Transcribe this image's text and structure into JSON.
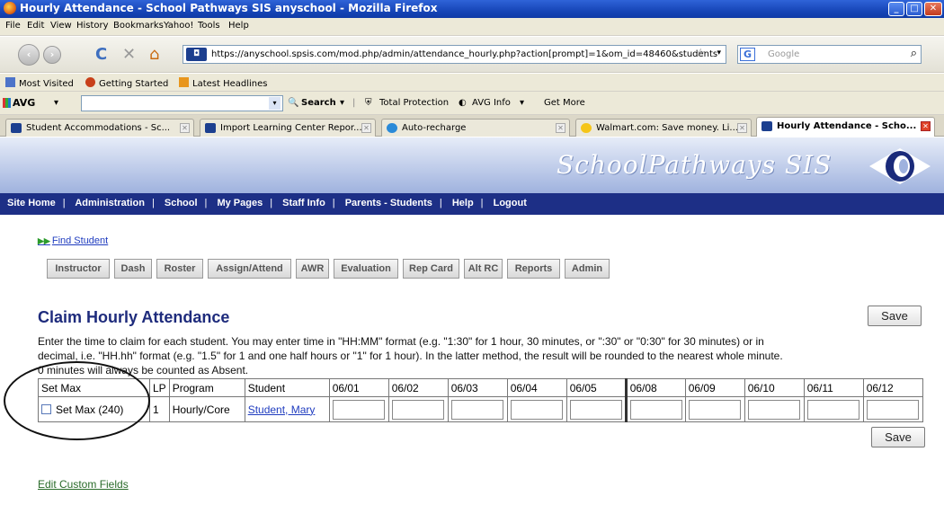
{
  "window": {
    "title": "Hourly Attendance - School Pathways SIS anyschool - Mozilla Firefox"
  },
  "menu": [
    "File",
    "Edit",
    "View",
    "History",
    "Bookmarks",
    "Yahoo!",
    "Tools",
    "Help"
  ],
  "address": {
    "url": "https://anyschool.spsis.com/mod.php/admin/attendance_hourly.php?action[prompt]=1&om_id=48460&students"
  },
  "search": {
    "placeholder": "Google"
  },
  "bookmarks": [
    "Most Visited",
    "Getting Started",
    "Latest Headlines"
  ],
  "avg": {
    "brand": "AVG",
    "search": "Search",
    "total_protection": "Total Protection",
    "info": "AVG Info",
    "get_more": "Get More"
  },
  "tabs": [
    {
      "label": "Student Accommodations - Sc...",
      "active": false
    },
    {
      "label": "Import Learning Center Repor...",
      "active": false
    },
    {
      "label": "Auto-recharge",
      "active": false
    },
    {
      "label": "Walmart.com: Save money. Li...",
      "active": false
    },
    {
      "label": "Hourly Attendance - Scho...",
      "active": true
    }
  ],
  "site": {
    "brand": "SchoolPathways SIS",
    "nav": [
      "Site Home",
      "Administration",
      "School",
      "My Pages",
      "Staff Info",
      "Parents - Students",
      "Help",
      "Logout"
    ]
  },
  "page": {
    "find_student": "Find Student",
    "subtabs": [
      "Instructor",
      "Dash",
      "Roster",
      "Assign/Attend",
      "AWR",
      "Evaluation",
      "Rep Card",
      "Alt RC",
      "Reports",
      "Admin"
    ],
    "title": "Claim Hourly Attendance",
    "save_label": "Save",
    "instructions_1": "Enter the time to claim for each student. You may enter time in \"HH:MM\" format (e.g. \"1:30\" for 1 hour, 30 minutes, or \":30\" or \"0:30\" for 30 minutes) or in",
    "instructions_2": "decimal, i.e. \"HH.hh\" format (e.g. \"1.5\" for 1 and one half hours or \"1\" for 1 hour). In the latter method, the result will be rounded to the nearest whole minute.",
    "instructions_3": "0 minutes will always be counted as Absent.",
    "edit_custom_fields": "Edit Custom Fields"
  },
  "table": {
    "headers": [
      "Set Max",
      "LP",
      "Program",
      "Student",
      "06/01",
      "06/02",
      "06/03",
      "06/04",
      "06/05",
      "06/08",
      "06/09",
      "06/10",
      "06/11",
      "06/12"
    ],
    "rows": [
      {
        "set_max": "Set Max (240)",
        "lp": "1",
        "program": "Hourly/Core",
        "student": "Student, Mary"
      }
    ]
  }
}
